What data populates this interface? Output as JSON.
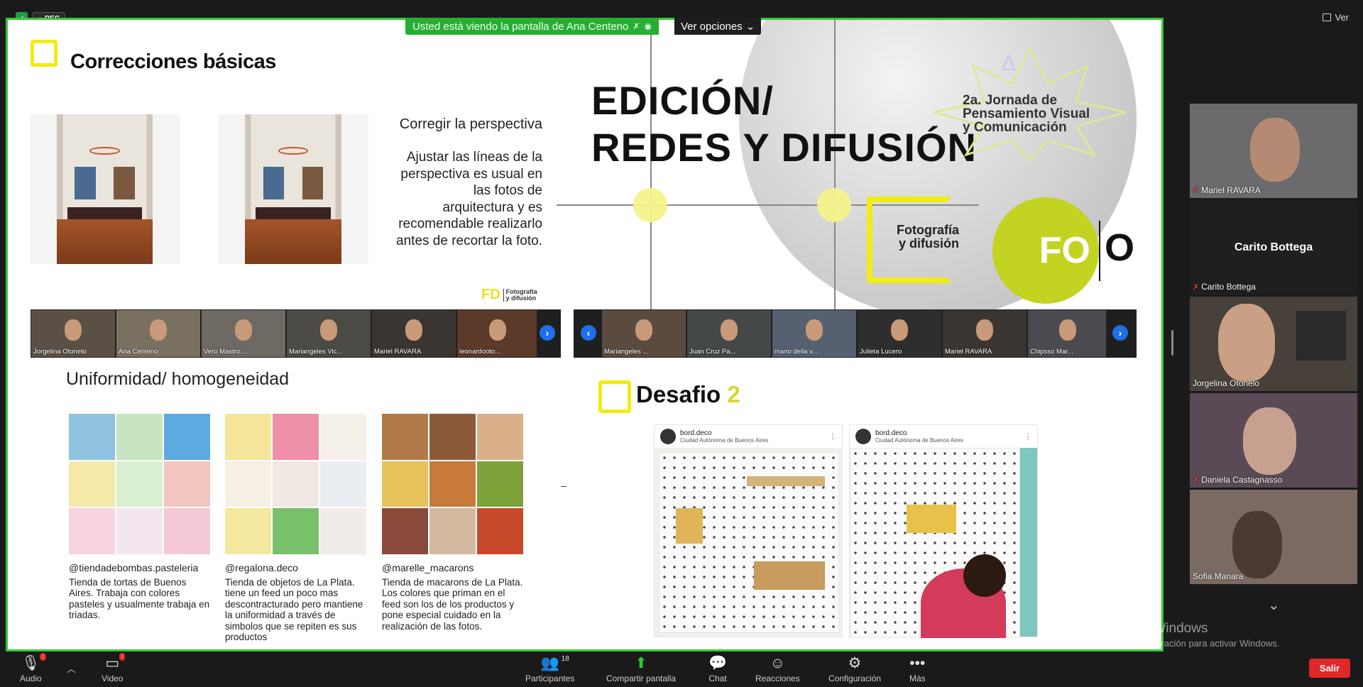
{
  "top": {
    "rec_label": "REC",
    "ver_label": "Ver"
  },
  "share": {
    "banner": "Usted está viendo la pantalla de Ana Centeno",
    "options": "Ver opciones"
  },
  "slide": {
    "corr_title": "Correcciones básicas",
    "persp_title": "Corregir la perspectiva",
    "persp_lines": [
      "Ajustar las líneas de la",
      "perspectiva es usual en",
      "las fotos de",
      "arquitectura y es",
      "recomendable realizarlo",
      "antes de recortar la foto."
    ],
    "fd_logo": "FD",
    "fd_logo_text": [
      "Fotografía",
      "y difusión"
    ],
    "edicion": [
      "EDICIÓN/",
      "REDES Y DIFUSIÓN"
    ],
    "jornada": [
      "2a. Jornada de",
      "Pensamiento Visual",
      "y Comunicación"
    ],
    "fyd": [
      "Fotografía",
      "y difusión"
    ],
    "fo_logo": "FO",
    "fo_logo_b": "O",
    "unif_title": "Uniformidad/ homogeneidad",
    "captions": [
      {
        "handle": "@tiendadebombas.pasteleria",
        "text": "Tienda de tortas de Buenos Aires. Trabaja con colores pasteles y usualmente trabaja en triadas."
      },
      {
        "handle": "@regalona.deco",
        "text": "Tienda de objetos de La Plata. tiene un feed un poco mas descontracturado pero mantiene la uniformidad a través de simbolos que se repiten es sus productos"
      },
      {
        "handle": "@marelle_macarons",
        "text": "Tienda de macarons de La Plata. Los colores que priman en el feed son los de los productos y pone especial cuidado en la realización de las fotos."
      }
    ],
    "desafio": "Desafio",
    "desafio_num": "2",
    "posts": [
      {
        "account": "bord.deco",
        "location": "Ciudad Autónoma de Buenos Aires"
      },
      {
        "account": "bord.deco",
        "location": "Ciudad Autónoma de Buenos Aires"
      }
    ],
    "dash": "–"
  },
  "strip_left": [
    "Jorgelina Otonelo",
    "Ana Centeno",
    "Vero Mastro...",
    "Mariangeles Vic...",
    "Mariel RAVARA",
    "leonardooto..."
  ],
  "strip_right": [
    "Mariangeles ...",
    "Juan Cruz Pa...",
    "mario della v...",
    "Julieta Lucero",
    "Mariel RAVARA",
    "Chipsso Mar..."
  ],
  "panel": [
    {
      "name": "Mariel RAVARA",
      "muted": true
    },
    {
      "name": "Carito Bottega",
      "muted": true,
      "no_video": true
    },
    {
      "name": "Jorgelina Otonelo",
      "muted": false
    },
    {
      "name": "Daniela Castagnasso",
      "muted": true
    },
    {
      "name": "Sofia Manara",
      "muted": false
    }
  ],
  "watermark": {
    "line1": "Activar Windows",
    "line2": "Ve a Configuración para activar Windows."
  },
  "toolbar": {
    "audio": "Audio",
    "video": "Video",
    "participants": "Participantes",
    "participants_count": "18",
    "share": "Compartir pantalla",
    "chat": "Chat",
    "reactions": "Reacciones",
    "settings": "Configuración",
    "more": "Más",
    "leave": "Salir"
  },
  "colors": {
    "share_border": "#2fcc32",
    "accent_yellow": "#f1ec12",
    "leave": "#e02828",
    "lime": "#c3d322"
  }
}
